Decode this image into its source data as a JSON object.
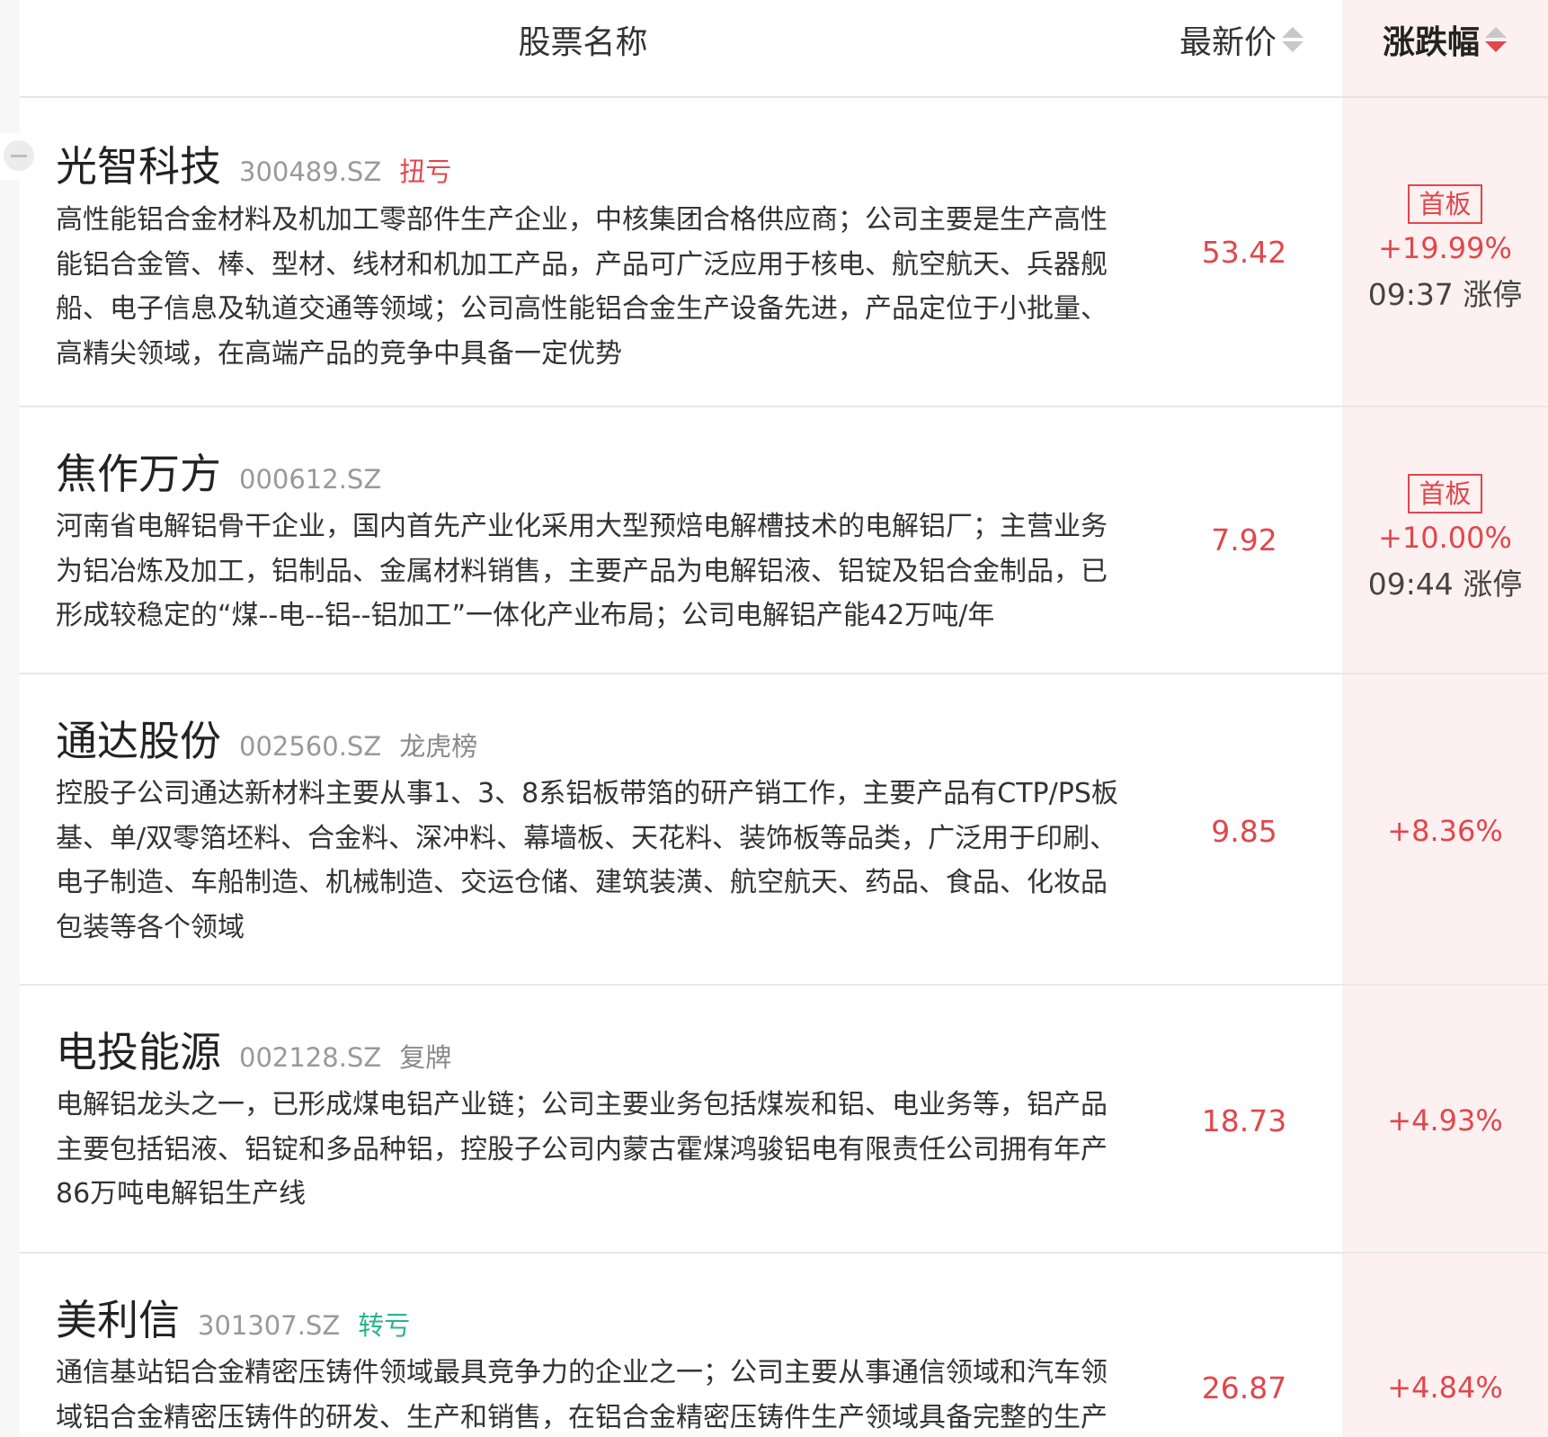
{
  "header": {
    "name_label": "股票名称",
    "price_label": "最新价",
    "change_label": "涨跌幅"
  },
  "colors": {
    "up_red": "#e0474c",
    "tag_green": "#2bb38a",
    "highlight_column_bg": "#fdf0f0"
  },
  "rows": [
    {
      "name": "光智科技",
      "code": "300489.SZ",
      "tag": "扭亏",
      "description": "高性能铝合金材料及机加工零部件生产企业，中核集团合格供应商；公司主要是生产高性能铝合金管、棒、型材、线材和机加工产品，产品可广泛应用于核电、航空航天、兵器舰船、电子信息及轨道交通等领域；公司高性能铝合金生产设备先进，产品定位于小批量、高精尖领域，在高端产品的竞争中具备一定优势",
      "price": "53.42",
      "badge": "首板",
      "change": "+19.99%",
      "limit_info": "09:37 涨停"
    },
    {
      "name": "焦作万方",
      "code": "000612.SZ",
      "tag": "",
      "description": "河南省电解铝骨干企业，国内首先产业化采用大型预焙电解槽技术的电解铝厂；主营业务为铝冶炼及加工，铝制品、金属材料销售，主要产品为电解铝液、铝锭及铝合金制品，已形成较稳定的“煤--电--铝--铝加工”一体化产业布局；公司电解铝产能42万吨/年",
      "price": "7.92",
      "badge": "首板",
      "change": "+10.00%",
      "limit_info": "09:44 涨停"
    },
    {
      "name": "通达股份",
      "code": "002560.SZ",
      "tag": "龙虎榜",
      "description": "控股子公司通达新材料主要从事1、3、8系铝板带箔的研产销工作，主要产品有CTP/PS板基、单/双零箔坯料、合金料、深冲料、幕墙板、天花料、装饰板等品类，广泛用于印刷、电子制造、车船制造、机械制造、交运仓储、建筑装潢、航空航天、药品、食品、化妆品包装等各个领域",
      "price": "9.85",
      "change": "+8.36%"
    },
    {
      "name": "电投能源",
      "code": "002128.SZ",
      "tag": "复牌",
      "description": "电解铝龙头之一，已形成煤电铝产业链；公司主要业务包括煤炭和铝、电业务等，铝产品主要包括铝液、铝锭和多品种铝，控股子公司内蒙古霍煤鸿骏铝电有限责任公司拥有年产86万吨电解铝生产线",
      "price": "18.73",
      "change": "+4.93%"
    },
    {
      "name": "美利信",
      "code": "301307.SZ",
      "tag": "转亏",
      "description": "通信基站铝合金精密压铸件领域最具竞争力的企业之一；公司主要从事通信领域和汽车领域铝合金精密压铸件的研发、生产和销售，在铝合金精密压铸件生产领域具备完整的生产",
      "price": "26.87",
      "change": "+4.84%"
    }
  ]
}
